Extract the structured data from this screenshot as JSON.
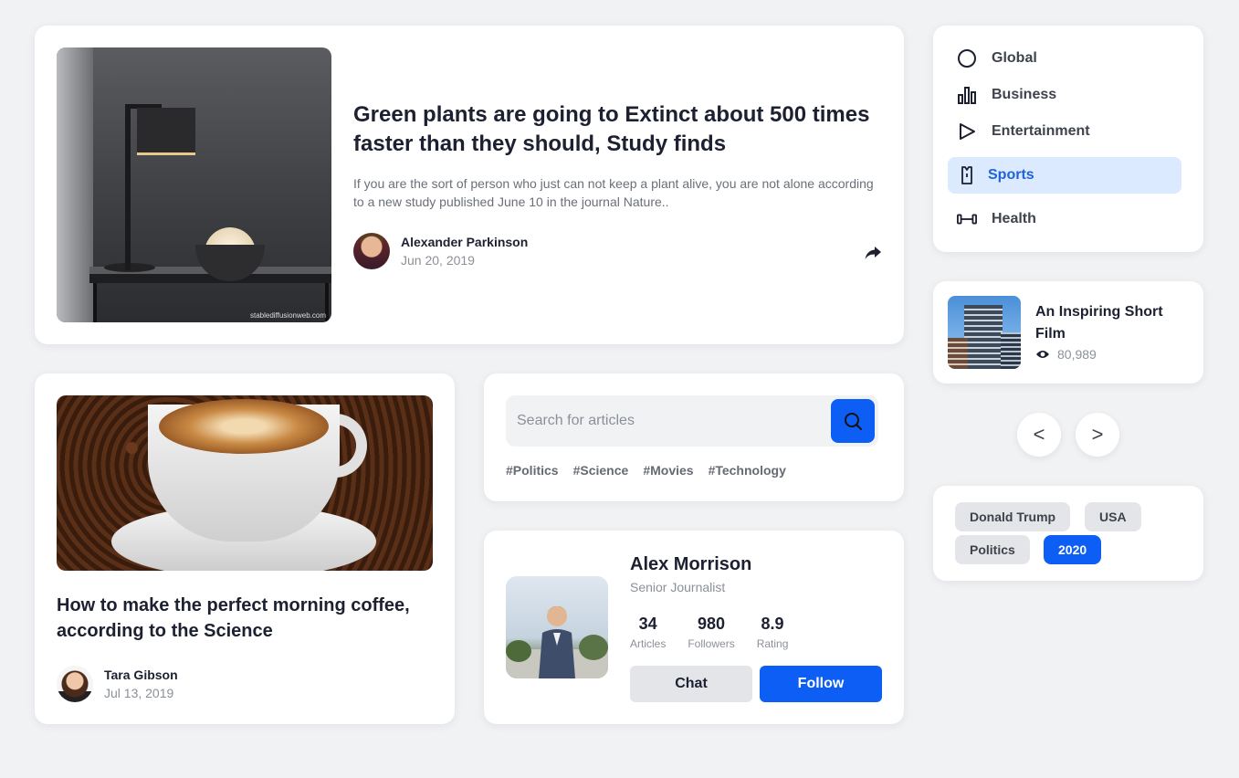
{
  "featured": {
    "watermark": "stablediffusionweb.com",
    "title": "Green plants are going to Extinct about 500 times faster than they should, Study finds",
    "description": "If you are the sort of person who just can not keep a plant alive, you are not alone according to a new study published June 10 in the journal Nature..",
    "author": "Alexander Parkinson",
    "date": "Jun 20, 2019",
    "share_icon": "share-icon"
  },
  "coffee": {
    "title": "How to make the perfect morning coffee, according to the Science",
    "author": "Tara Gibson",
    "date": "Jul 13, 2019"
  },
  "search": {
    "placeholder": "Search for articles",
    "hashtags": [
      "#Politics",
      "#Science",
      "#Movies",
      "#Technology"
    ]
  },
  "profile": {
    "name": "Alex Morrison",
    "role": "Senior Journalist",
    "stats": [
      {
        "value": "34",
        "label": "Articles"
      },
      {
        "value": "980",
        "label": "Followers"
      },
      {
        "value": "8.9",
        "label": "Rating"
      }
    ],
    "chat_label": "Chat",
    "follow_label": "Follow"
  },
  "categories": [
    {
      "label": "Global",
      "icon": "circle-icon"
    },
    {
      "label": "Business",
      "icon": "bar-chart-icon"
    },
    {
      "label": "Entertainment",
      "icon": "play-icon"
    },
    {
      "label": "Sports",
      "icon": "shirt-icon",
      "active": true
    },
    {
      "label": "Health",
      "icon": "dumbbell-icon"
    }
  ],
  "film": {
    "title": "An Inspiring Short Film",
    "views": "80,989"
  },
  "nav": {
    "prev": "<",
    "next": ">"
  },
  "tags": [
    {
      "label": "Donald Trump"
    },
    {
      "label": "USA"
    },
    {
      "label": "Politics"
    },
    {
      "label": "2020",
      "active": true
    }
  ],
  "colors": {
    "accent": "#0d5ef5",
    "active_bg": "#dbeafe",
    "active_text": "#1f63d6"
  }
}
